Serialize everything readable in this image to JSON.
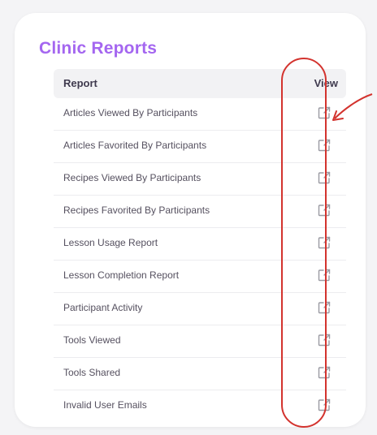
{
  "card": {
    "title": "Clinic Reports"
  },
  "table": {
    "header_report": "Report",
    "header_view": "View",
    "rows": [
      {
        "label": "Articles Viewed By Participants"
      },
      {
        "label": "Articles Favorited By Participants"
      },
      {
        "label": "Recipes Viewed By Participants"
      },
      {
        "label": "Recipes Favorited By Participants"
      },
      {
        "label": "Lesson Usage Report"
      },
      {
        "label": "Lesson Completion Report"
      },
      {
        "label": "Participant Activity"
      },
      {
        "label": "Tools Viewed"
      },
      {
        "label": "Tools Shared"
      },
      {
        "label": "Invalid User Emails"
      }
    ]
  },
  "icons": {
    "view": "external-link-icon"
  },
  "colors": {
    "title": "#a466f0",
    "header_bg": "#f2f2f4",
    "annotation": "#d3332e",
    "icon": "#9a9aa2"
  }
}
